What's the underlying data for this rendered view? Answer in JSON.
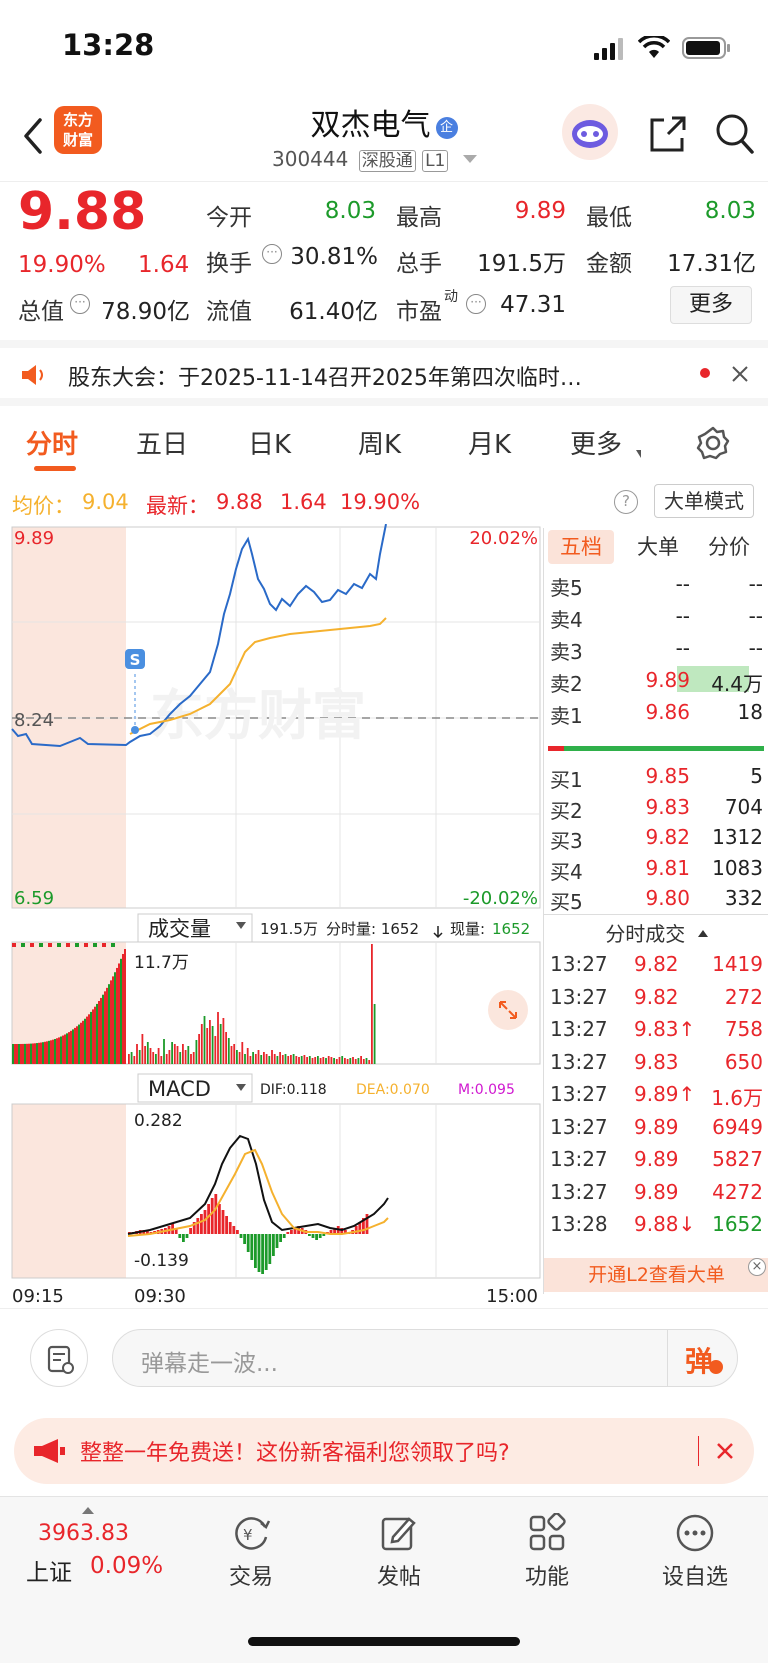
{
  "status": {
    "time": "13:28"
  },
  "header": {
    "logo_line1": "东方",
    "logo_line2": "财富",
    "title": "双杰电气",
    "title_badge": "企",
    "code": "300444",
    "tag1": "深股通",
    "tag2": "L1"
  },
  "quote": {
    "price": "9.88",
    "change_pct": "19.90%",
    "change": "1.64",
    "open_label": "今开",
    "open": "8.03",
    "high_label": "最高",
    "high": "9.89",
    "low_label": "最低",
    "low": "8.03",
    "turnover_label": "换手",
    "turnover": "30.81%",
    "volume_label": "总手",
    "volume": "191.5万",
    "amount_label": "金额",
    "amount": "17.31亿",
    "mktcap_label": "总值",
    "mktcap": "78.90亿",
    "float_label": "流值",
    "float": "61.40亿",
    "pe_label": "市盈",
    "pe_sup": "动",
    "pe": "47.31",
    "more_button": "更多"
  },
  "notice": {
    "text": "股东大会：于2025-11-14召开2025年第四次临时…"
  },
  "tabs": [
    "分时",
    "五日",
    "日K",
    "周K",
    "月K",
    "更多"
  ],
  "infobar": {
    "avg_label": "均价：",
    "avg": "9.04",
    "latest_label": "最新：",
    "latest": "9.88",
    "latest_chg": "1.64",
    "latest_pct": "19.90%",
    "big_mode": "大单模式"
  },
  "chart": {
    "y_top": "9.89",
    "y_mid": "8.24",
    "y_bot": "6.59",
    "pct_top": "20.02%",
    "pct_bot": "-20.02%",
    "s_marker": "S",
    "vol_selector": "成交量",
    "vol_info_total": "191.5万",
    "vol_info_label": "分时量: 1652",
    "vol_info_now": "现量:",
    "vol_info_now_val": "1652",
    "vol_max": "11.7万",
    "macd_selector": "MACD",
    "dif": "DIF:0.118",
    "dea": "DEA:0.070",
    "m": "M:0.095",
    "macd_top": "0.282",
    "macd_bot": "-0.139",
    "t_start": "09:15",
    "t_open": "09:30",
    "t_end": "15:00",
    "watermark": "东方财富",
    "colors": {
      "price": "#2a6ac8",
      "avg": "#f5b12e",
      "up": "#e8262b",
      "down": "#1c9a2a"
    }
  },
  "orderbook": {
    "tabs": [
      "五档",
      "大单",
      "分价"
    ],
    "asks": [
      {
        "label": "卖5",
        "price": "--",
        "vol": "--"
      },
      {
        "label": "卖4",
        "price": "--",
        "vol": "--"
      },
      {
        "label": "卖3",
        "price": "--",
        "vol": "--"
      },
      {
        "label": "卖2",
        "price": "9.89",
        "vol": "4.4万"
      },
      {
        "label": "卖1",
        "price": "9.86",
        "vol": "18"
      }
    ],
    "bids": [
      {
        "label": "买1",
        "price": "9.85",
        "vol": "5"
      },
      {
        "label": "买2",
        "price": "9.83",
        "vol": "704"
      },
      {
        "label": "买3",
        "price": "9.82",
        "vol": "1312"
      },
      {
        "label": "买4",
        "price": "9.81",
        "vol": "1083"
      },
      {
        "label": "买5",
        "price": "9.80",
        "vol": "332"
      }
    ],
    "trades_title": "分时成交",
    "trades": [
      {
        "time": "13:27",
        "price": "9.82",
        "vol": "1419"
      },
      {
        "time": "13:27",
        "price": "9.82",
        "vol": "272"
      },
      {
        "time": "13:27",
        "price": "9.83↑",
        "vol": "758"
      },
      {
        "time": "13:27",
        "price": "9.83",
        "vol": "650"
      },
      {
        "time": "13:27",
        "price": "9.89↑",
        "vol": "1.6万"
      },
      {
        "time": "13:27",
        "price": "9.89",
        "vol": "6949"
      },
      {
        "time": "13:27",
        "price": "9.89",
        "vol": "5827"
      },
      {
        "time": "13:27",
        "price": "9.89",
        "vol": "4272"
      },
      {
        "time": "13:28",
        "price": "9.88↓",
        "vol": "1652"
      }
    ],
    "l2_banner": "开通L2查看大单"
  },
  "comment": {
    "placeholder": "弹幕走一波...",
    "danmu_button": "弹"
  },
  "promo": {
    "text": "整整一年免费送！这份新客福利您领取了吗?"
  },
  "bottom_nav": {
    "index_value": "3963.83",
    "index_name": "上证",
    "index_pct": "0.09%",
    "items": [
      "交易",
      "发帖",
      "功能",
      "设自选"
    ]
  }
}
